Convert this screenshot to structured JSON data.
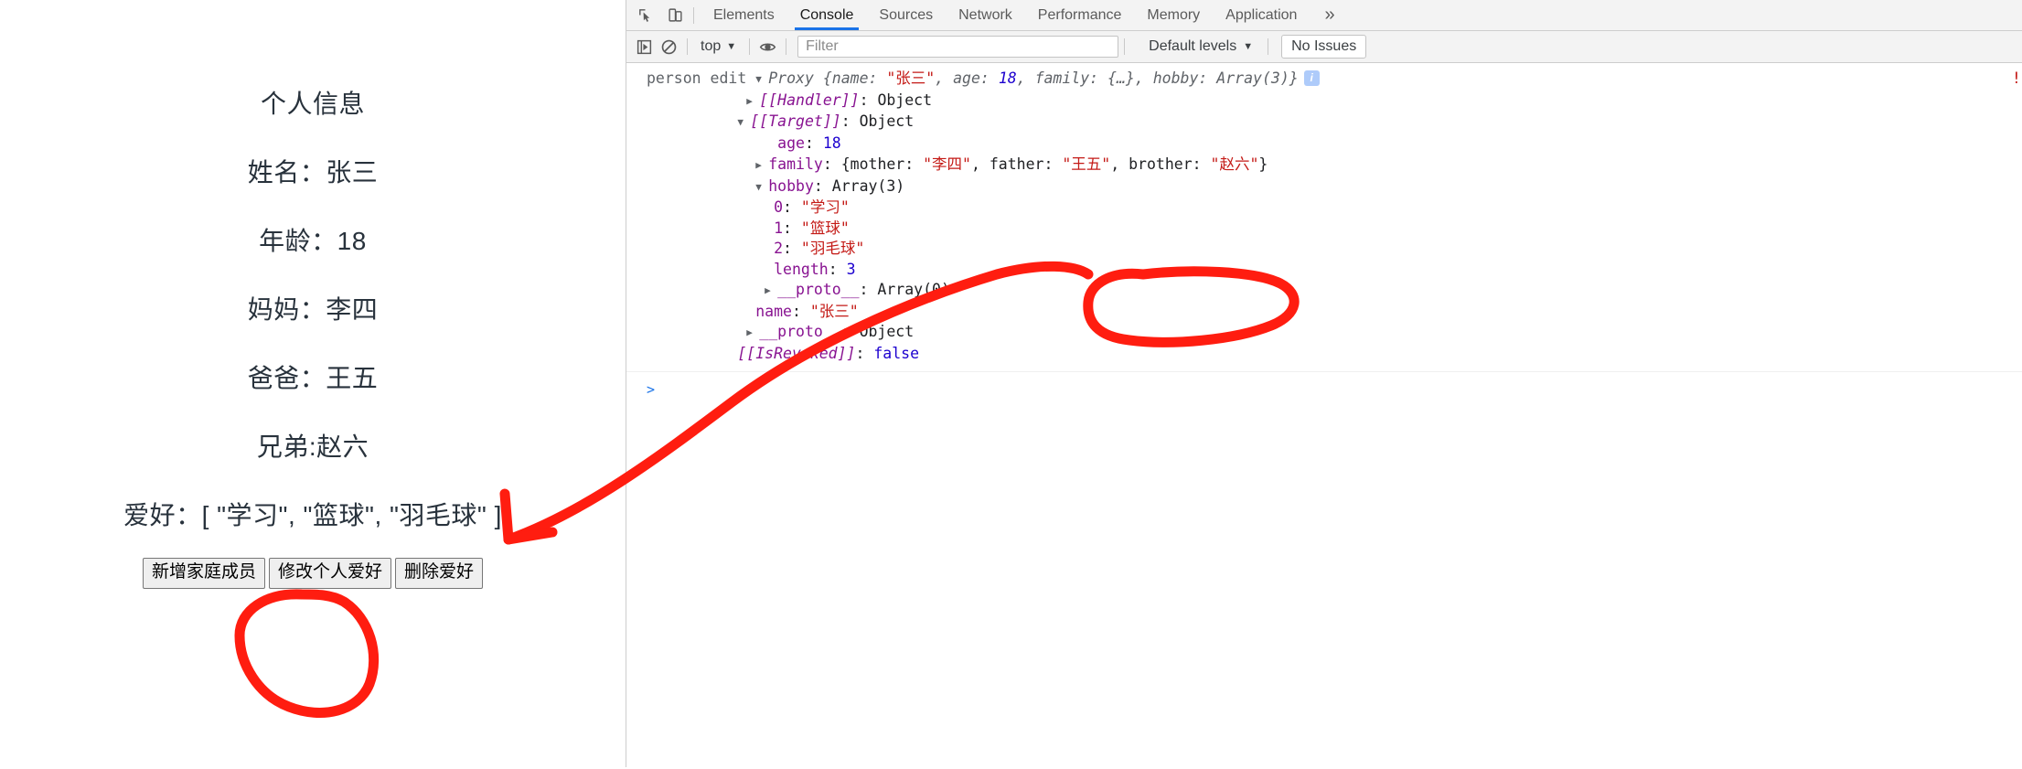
{
  "page": {
    "title": "个人信息",
    "fields": [
      "姓名：张三",
      "年龄：18",
      "妈妈：李四",
      "爸爸：王五",
      "兄弟:赵六"
    ],
    "hobby_line": "爱好：[ \"学习\", \"篮球\", \"羽毛球\" ]",
    "buttons": [
      "新增家庭成员",
      "修改个人爱好",
      "删除爱好"
    ]
  },
  "devtools": {
    "icons": {
      "inspect": "inspect-element-icon",
      "device": "device-toolbar-icon",
      "execute": "execute-snippet-icon",
      "clear": "clear-console-icon",
      "eye": "console-settings-eye-icon"
    },
    "tabs": [
      {
        "label": "Elements",
        "active": false
      },
      {
        "label": "Console",
        "active": true
      },
      {
        "label": "Sources",
        "active": false
      },
      {
        "label": "Network",
        "active": false
      },
      {
        "label": "Performance",
        "active": false
      },
      {
        "label": "Memory",
        "active": false
      },
      {
        "label": "Application",
        "active": false
      }
    ],
    "more_tabs": "»",
    "toolbar": {
      "context": "top",
      "caret": "▼",
      "filter_placeholder": "Filter",
      "filter_value": "",
      "levels": "Default levels",
      "issues": "No Issues"
    },
    "console": {
      "source_label": "person edit",
      "prompt": ">",
      "summary": {
        "type": "Proxy",
        "text": "{name: \"张三\", age: 18, family: {…}, hobby: Array(3)}",
        "name_key": "name:",
        "name_val": "\"张三\"",
        "age_key": "age:",
        "age_val": "18",
        "family_key": "family:",
        "family_val": "{…}",
        "hobby_key": "hobby:",
        "hobby_val": "Array(3)",
        "info_badge": "i"
      },
      "lines": {
        "handler_key": "[[Handler]]",
        "handler_val": "Object",
        "target_key": "[[Target]]",
        "target_val": "Object",
        "age_key": "age",
        "age_val": "18",
        "family_key": "family",
        "family_mother_key": "mother:",
        "family_mother_val": "\"李四\"",
        "family_father_key": "father:",
        "family_father_val": "\"王五\"",
        "family_brother_key": "brother:",
        "family_brother_val": "\"赵六\"",
        "hobby_key": "hobby",
        "hobby_val": "Array(3)",
        "hobby_0_key": "0",
        "hobby_0_val": "\"学习\"",
        "hobby_1_key": "1",
        "hobby_1_val": "\"篮球\"",
        "hobby_2_key": "2",
        "hobby_2_val": "\"羽毛球\"",
        "length_key": "length",
        "length_val": "3",
        "arr_proto_key": "__proto__",
        "arr_proto_val": "Array(0)",
        "name_key": "name",
        "name_val": "\"张三\"",
        "obj_proto_key": "__proto__",
        "obj_proto_val": "Object",
        "isrevoked_key": "[[IsRevoked]]",
        "isrevoked_val": "false"
      },
      "warning_mark": "!"
    }
  },
  "annotation": {
    "color": "#ff1d10",
    "shapes": "hand-drawn red arrow from hobby list to console hobby array, circle around console hobby 0/1 entries, circle around 修改个人爱好 button"
  }
}
